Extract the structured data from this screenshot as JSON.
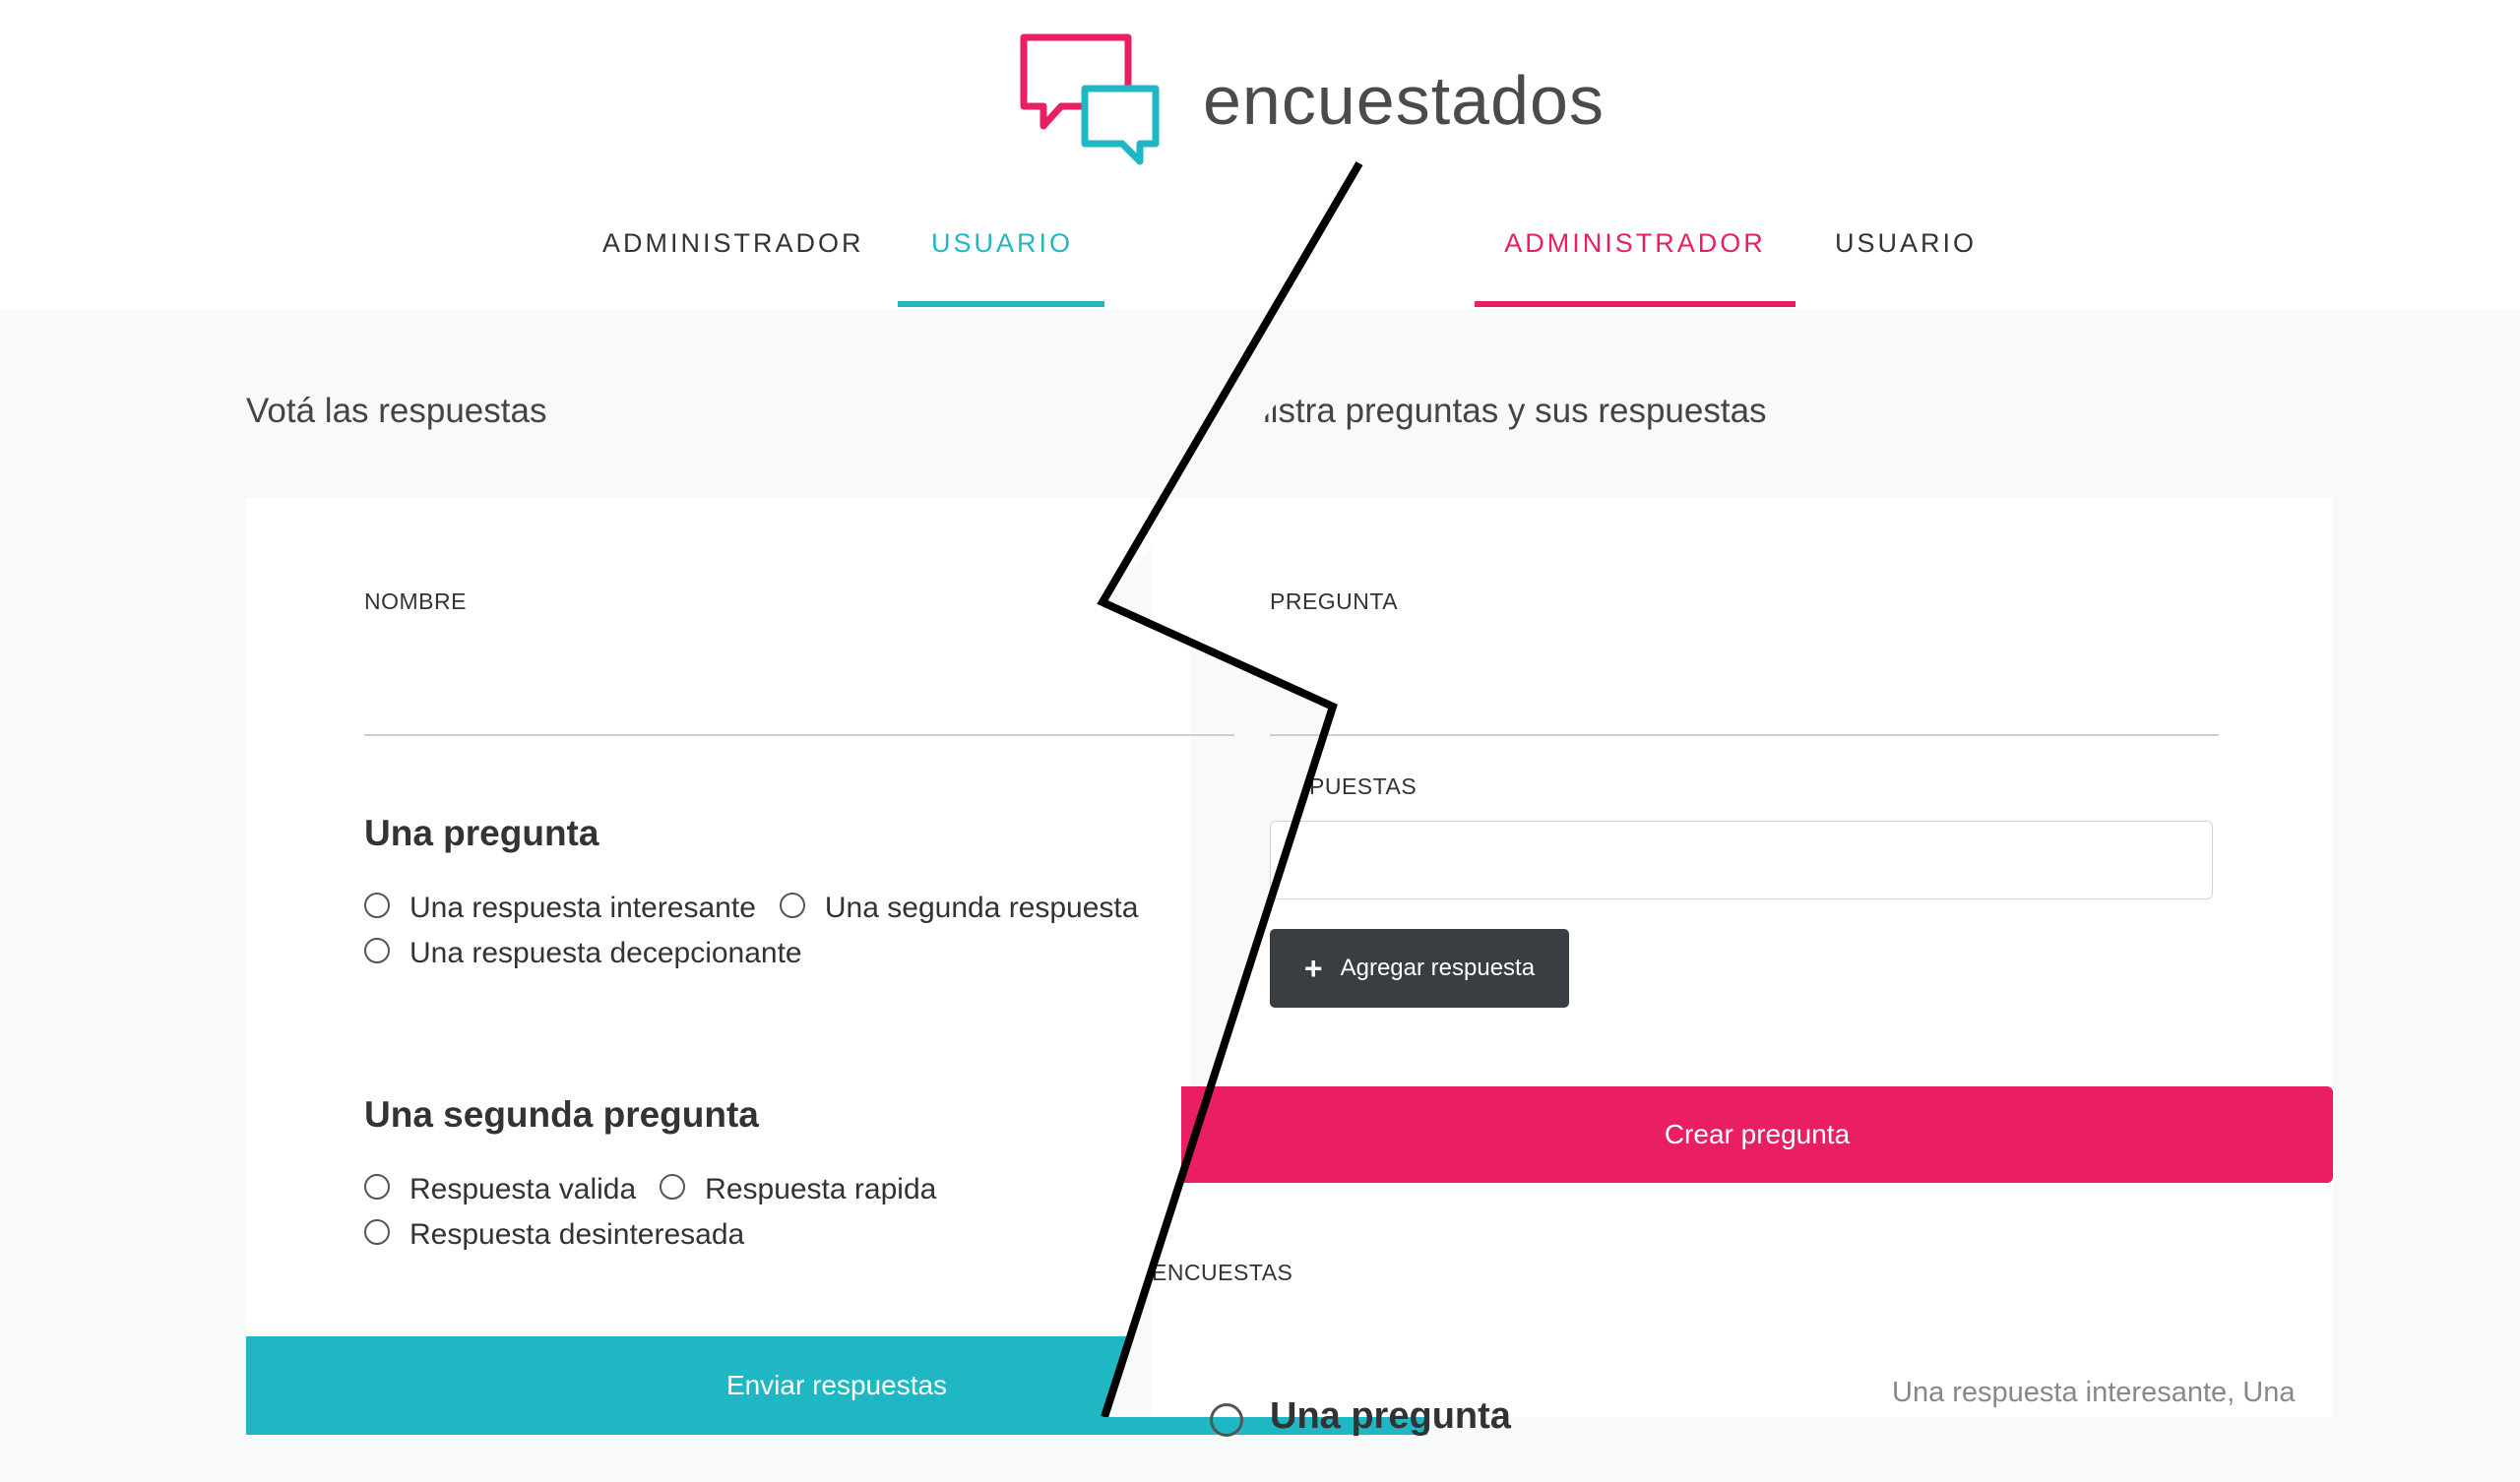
{
  "brand": {
    "name": "encuestados",
    "colors": {
      "pink": "#e91e63",
      "teal": "#20b7c4",
      "dark": "#393e42"
    }
  },
  "left_panel": {
    "tabs": {
      "admin_label": "ADMINISTRADOR",
      "user_label": "USUARIO",
      "active": "USUARIO"
    },
    "page_title": "Votá las respuestas",
    "form": {
      "name_label": "NOMBRE",
      "name_value": ""
    },
    "questions": [
      {
        "title": "Una pregunta",
        "answers": [
          "Una respuesta interesante",
          "Una segunda respuesta",
          "Una respuesta decepcionante"
        ]
      },
      {
        "title": "Una segunda pregunta",
        "answers": [
          "Respuesta valida",
          "Respuesta rapida",
          "Respuesta desinteresada"
        ]
      }
    ],
    "submit_label": "Enviar respuestas"
  },
  "right_panel": {
    "tabs": {
      "admin_label": "ADMINISTRADOR",
      "user_label": "USUARIO",
      "active": "ADMINISTRADOR"
    },
    "page_title": "ega y administra preguntas y sus respuestas",
    "form": {
      "question_label": "PREGUNTA",
      "question_value": "",
      "answers_label": "PUESTAS",
      "answers_value": "",
      "add_answer_label": "Agregar respuesta",
      "create_label": "Crear pregunta"
    },
    "polls_label": "ENCUESTAS",
    "polls": [
      {
        "title": "Una pregunta",
        "answers_summary": "Una respuesta interesante, Una"
      }
    ]
  }
}
